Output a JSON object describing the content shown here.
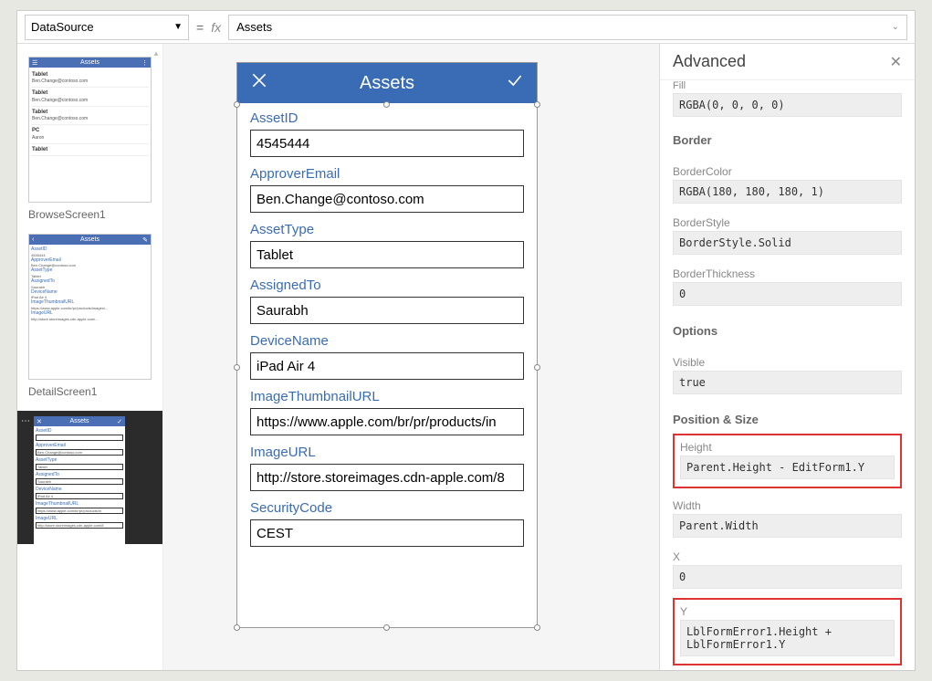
{
  "formulaBar": {
    "property": "DataSource",
    "formula": "Assets"
  },
  "thumbnails": {
    "browse": {
      "label": "BrowseScreen1",
      "header": "Assets",
      "rows": [
        {
          "title": "Tablet",
          "sub": "Ben.Change@contoso.com"
        },
        {
          "title": "Tablet",
          "sub": "Ben.Change@contoso.com"
        },
        {
          "title": "Tablet",
          "sub": "Ben.Change@contoso.com"
        },
        {
          "title": "PC",
          "sub": "Aaron"
        },
        {
          "title": "Tablet",
          "sub": ""
        }
      ]
    },
    "detail": {
      "label": "DetailScreen1",
      "header": "Assets",
      "lines": [
        "AssetID",
        "4545444",
        "ApproverEmail",
        "Ben.Change@contoso.com",
        "AssetType",
        "Tablet",
        "AssignedTo",
        "Saurabh",
        "DeviceName",
        "iPad Air 4",
        "ImageThumbnailURL",
        "https://www.apple.com/br/pr/products/images/...",
        "ImageURL",
        "http://store.storeimages.cdn-apple.com/..."
      ]
    },
    "edit": {
      "header": "Assets",
      "labels": [
        "AssetID",
        "ApproverEmail",
        "AssetType",
        "AssignedTo",
        "DeviceName",
        "ImageThumbnailURL",
        "ImageURL"
      ],
      "values": [
        "",
        "Ben.Change@contoso.com",
        "Tablet",
        "Saurabh",
        "iPad Air 4",
        "https://www.apple.com/br/pr/products/in",
        "http://store.storeimages.cdn-apple.com/8"
      ]
    }
  },
  "screen": {
    "title": "Assets",
    "fields": [
      {
        "label": "AssetID",
        "value": "4545444"
      },
      {
        "label": "ApproverEmail",
        "value": "Ben.Change@contoso.com"
      },
      {
        "label": "AssetType",
        "value": "Tablet"
      },
      {
        "label": "AssignedTo",
        "value": "Saurabh"
      },
      {
        "label": "DeviceName",
        "value": "iPad Air 4"
      },
      {
        "label": "ImageThumbnailURL",
        "value": "https://www.apple.com/br/pr/products/in"
      },
      {
        "label": "ImageURL",
        "value": "http://store.storeimages.cdn-apple.com/8"
      },
      {
        "label": "SecurityCode",
        "value": "CEST"
      }
    ]
  },
  "advanced": {
    "title": "Advanced",
    "fillLabel": "Fill",
    "fill": "RGBA(0, 0, 0, 0)",
    "sections": {
      "border": "Border",
      "options": "Options",
      "position": "Position & Size"
    },
    "props": {
      "borderColorLabel": "BorderColor",
      "borderColor": "RGBA(180, 180, 180, 1)",
      "borderStyleLabel": "BorderStyle",
      "borderStyle": "BorderStyle.Solid",
      "borderThicknessLabel": "BorderThickness",
      "borderThickness": "0",
      "visibleLabel": "Visible",
      "visible": "true",
      "heightLabel": "Height",
      "height": "Parent.Height - EditForm1.Y",
      "widthLabel": "Width",
      "width": "Parent.Width",
      "xLabel": "X",
      "x": "0",
      "yLabel": "Y",
      "y": "LblFormError1.Height + LblFormError1.Y"
    }
  }
}
